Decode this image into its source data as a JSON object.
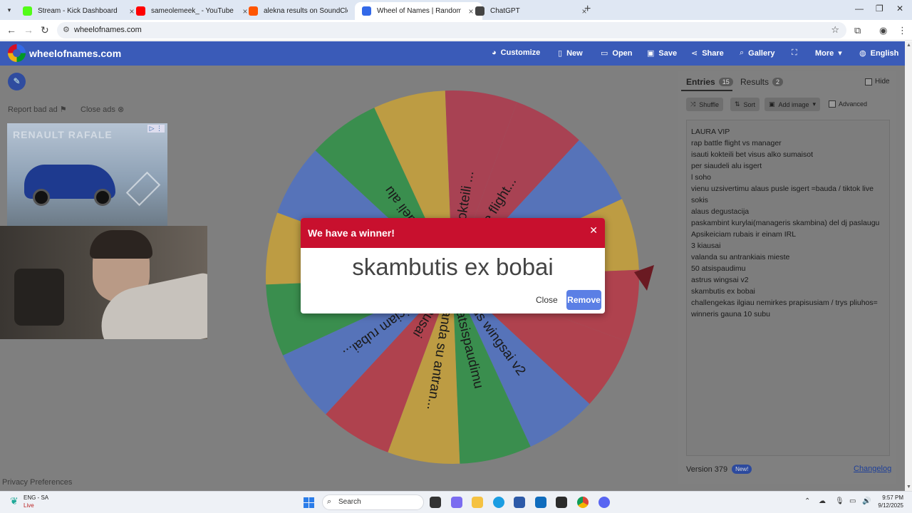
{
  "browser": {
    "tabs": [
      {
        "title": "Stream - Kick Dashboard",
        "favicon_color": "#53fc18",
        "active": false
      },
      {
        "title": "sameolemeek_ - YouTube",
        "favicon_color": "#ff0000",
        "active": false
      },
      {
        "title": "alekna results on SoundCloud",
        "favicon_color": "#ff5500",
        "active": false
      },
      {
        "title": "Wheel of Names | Random nam",
        "favicon_color": "#3369e8",
        "active": true
      },
      {
        "title": "ChatGPT",
        "favicon_color": "#444444",
        "active": false
      }
    ],
    "url": "wheelofnames.com"
  },
  "site": {
    "brand": "wheelofnames.com",
    "nav": {
      "customize": "Customize",
      "new": "New",
      "open": "Open",
      "save": "Save",
      "share": "Share",
      "gallery": "Gallery",
      "more": "More",
      "language": "English"
    },
    "report_bad_ad": "Report bad ad",
    "close_ads": "Close ads",
    "ad_brand": "RENAULT RAFALE",
    "privacy": "Privacy Preferences"
  },
  "wheel": {
    "segments": [
      {
        "label": "isauti kokteili ...",
        "color": "#c8102e"
      },
      {
        "label": "rap battle flight...",
        "color": "#c8102e"
      },
      {
        "label": "LAURA VIP",
        "color": "#3369e8"
      },
      {
        "label": "...gi...",
        "color": "#eeb211"
      },
      {
        "label": "...nu...",
        "color": "#d50f25"
      },
      {
        "label": "...bobai",
        "color": "#d50f25"
      },
      {
        "label": "astrus wingsai v2",
        "color": "#3369e8"
      },
      {
        "label": "50 atsispaudimu",
        "color": "#009925"
      },
      {
        "label": "valanda su antran...",
        "color": "#eeb211"
      },
      {
        "label": "3 kiausai",
        "color": "#d50f25"
      },
      {
        "label": "Apsikeiciam rubai...",
        "color": "#3369e8"
      },
      {
        "label": "...kambint kuryla...",
        "color": "#009925"
      },
      {
        "label": "...cija",
        "color": "#eeb211"
      },
      {
        "label": "...soho",
        "color": "#3369e8"
      },
      {
        "label": "...er siaudeli alu",
        "color": "#009925"
      },
      {
        "label": "",
        "color": "#eeb211"
      }
    ]
  },
  "modal": {
    "title": "We have a winner!",
    "winner": "skambutis ex bobai",
    "close": "Close",
    "remove": "Remove"
  },
  "panel": {
    "entries_tab": "Entries",
    "entries_count": "15",
    "results_tab": "Results",
    "results_count": "2",
    "hide": "Hide",
    "shuffle": "Shuffle",
    "sort": "Sort",
    "add_image": "Add image",
    "advanced": "Advanced",
    "entries": [
      "LAURA VIP",
      "rap battle flight vs manager",
      "isauti kokteili bet visus alko sumaisot",
      "per siaudeli alu isgert",
      "l soho",
      "vienu uzsivertimu alaus pusle isgert =bauda / tiktok live",
      "sokis",
      "alaus degustacija",
      "paskambint kurylai(manageris skambina) del dj paslaugu",
      "Apsikeiciam rubais ir einam IRL",
      "3 kiausai",
      "valanda su antrankiais mieste",
      "50 atsispaudimu",
      "astrus wingsai v2",
      "skambutis ex bobai",
      "challengekas ilgiau nemirkes prapisusiam / trys pliuhos=",
      "winneris gauna 10 subu"
    ],
    "version": "Version 379",
    "new_badge": "New!",
    "changelog": "Changelog"
  },
  "taskbar": {
    "lang": "ENG - SA",
    "live": "Live",
    "search": "Search",
    "time": "9:57 PM",
    "date": "9/12/2025"
  }
}
